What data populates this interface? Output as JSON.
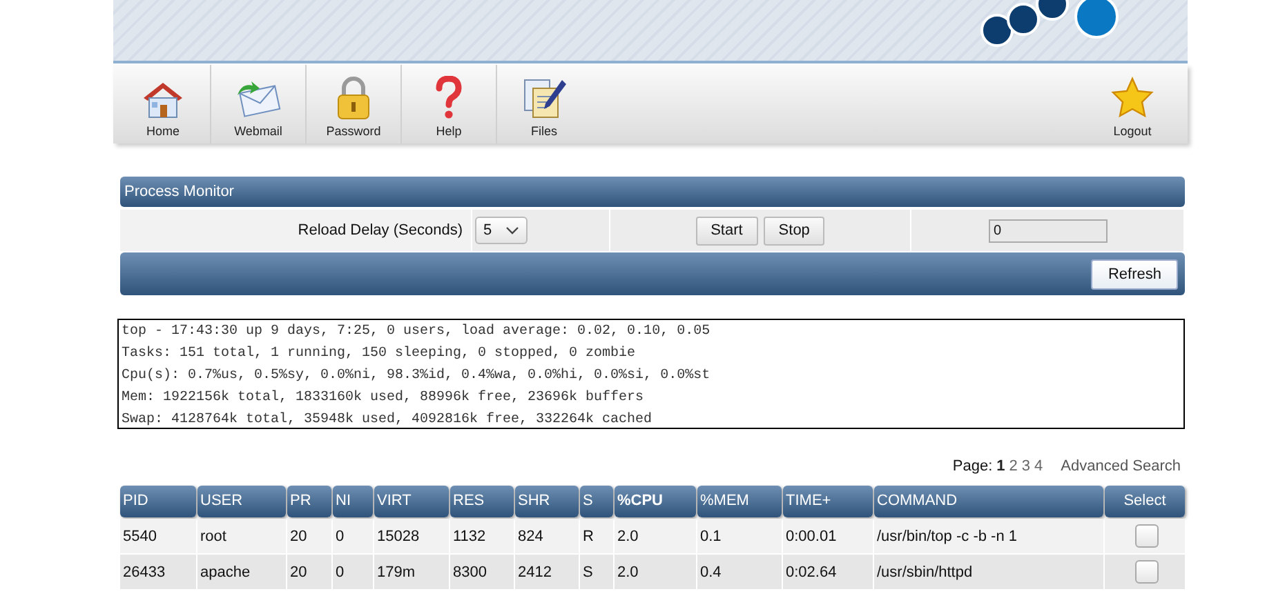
{
  "toolbar": {
    "items": [
      {
        "kind": "home",
        "label": "Home"
      },
      {
        "kind": "mail",
        "label": "Webmail"
      },
      {
        "kind": "lock",
        "label": "Password"
      },
      {
        "kind": "help",
        "label": "Help"
      },
      {
        "kind": "files",
        "label": "Files"
      }
    ],
    "logout": {
      "kind": "star",
      "label": "Logout"
    }
  },
  "process_monitor": {
    "title": "Process Monitor",
    "reload_label": "Reload Delay (Seconds)",
    "reload_value": "5",
    "buttons": [
      "Start",
      "Stop"
    ],
    "counter_value": "0",
    "refresh_button": "Refresh"
  },
  "summary": [
    "top - 17:43:30 up 9 days, 7:25, 0 users, load average: 0.02, 0.10, 0.05",
    "Tasks: 151 total, 1 running, 150 sleeping, 0 stopped, 0 zombie",
    "Cpu(s): 0.7%us, 0.5%sy, 0.0%ni, 98.3%id, 0.4%wa, 0.0%hi, 0.0%si, 0.0%st",
    "Mem: 1922156k total, 1833160k used, 88996k free, 23696k buffers",
    "Swap: 4128764k total, 35948k used, 4092816k free, 332264k cached"
  ],
  "pagination": {
    "label": "Page:",
    "pages": [
      {
        "label": "1",
        "selected": true
      },
      {
        "label": "2",
        "selected": false
      },
      {
        "label": "3",
        "selected": false
      },
      {
        "label": "4",
        "selected": false
      }
    ],
    "advanced_search": "Advanced Search"
  },
  "table": {
    "columns": [
      {
        "label": "PID",
        "selected": false
      },
      {
        "label": "USER",
        "selected": false
      },
      {
        "label": "PR",
        "selected": false
      },
      {
        "label": "NI",
        "selected": false
      },
      {
        "label": "VIRT",
        "selected": false
      },
      {
        "label": "RES",
        "selected": false
      },
      {
        "label": "SHR",
        "selected": false
      },
      {
        "label": "S",
        "selected": false
      },
      {
        "label": "%CPU",
        "selected": true
      },
      {
        "label": "%MEM",
        "selected": false
      },
      {
        "label": "TIME+",
        "selected": false
      },
      {
        "label": "COMMAND",
        "selected": false
      },
      {
        "label": "Select",
        "selected": false
      }
    ],
    "rows": [
      {
        "cells": [
          "5540",
          "root",
          "20",
          "0",
          "15028",
          "1132",
          "824",
          "R",
          "2.0",
          "0.1",
          "0:00.01",
          "/usr/bin/top -c -b -n 1"
        ],
        "checked": false
      },
      {
        "cells": [
          "26433",
          "apache",
          "20",
          "0",
          "179m",
          "8300",
          "2412",
          "S",
          "2.0",
          "0.4",
          "0:02.64",
          "/usr/sbin/httpd"
        ],
        "checked": false
      }
    ]
  }
}
